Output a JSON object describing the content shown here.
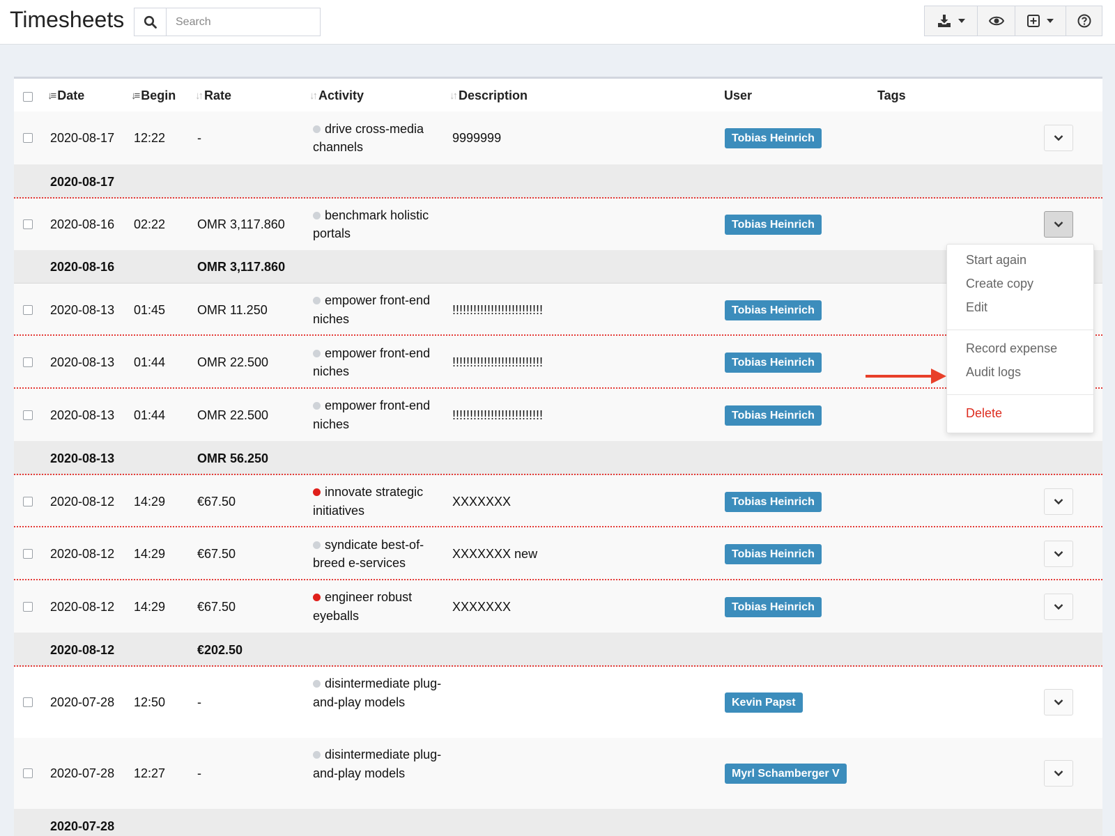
{
  "app": {
    "title": "Timesheets"
  },
  "search": {
    "placeholder": "Search"
  },
  "toolbar": {
    "buttons": [
      {
        "name": "export",
        "icon": "download-icon"
      },
      {
        "name": "visibility",
        "icon": "eye-icon"
      },
      {
        "name": "create",
        "icon": "plus-square-icon"
      },
      {
        "name": "help",
        "icon": "question-icon"
      }
    ]
  },
  "table": {
    "headers": {
      "date": "Date",
      "begin": "Begin",
      "rate": "Rate",
      "activity": "Activity",
      "description": "Description",
      "user": "User",
      "tags": "Tags"
    },
    "rows": [
      {
        "date": "2020-08-17",
        "begin": "12:22",
        "rate": "-",
        "activity": "drive cross-media channels",
        "activity_color": "#cfd3d8",
        "description": "9999999",
        "user": "Tobias Heinrich"
      },
      {
        "date": "2020-08-16",
        "begin": "02:22",
        "rate": "OMR 3,117.860",
        "activity": "benchmark holistic portals",
        "activity_color": "#cfd3d8",
        "description": "",
        "user": "Tobias Heinrich"
      },
      {
        "date": "2020-08-13",
        "begin": "01:45",
        "rate": "OMR 11.250",
        "activity": "empower front-end niches",
        "activity_color": "#cfd3d8",
        "description": "!!!!!!!!!!!!!!!!!!!!!!!!!!",
        "user": "Tobias Heinrich"
      },
      {
        "date": "2020-08-13",
        "begin": "01:44",
        "rate": "OMR 22.500",
        "activity": "empower front-end niches",
        "activity_color": "#cfd3d8",
        "description": "!!!!!!!!!!!!!!!!!!!!!!!!!!",
        "user": "Tobias Heinrich"
      },
      {
        "date": "2020-08-13",
        "begin": "01:44",
        "rate": "OMR 22.500",
        "activity": "empower front-end niches",
        "activity_color": "#cfd3d8",
        "description": "!!!!!!!!!!!!!!!!!!!!!!!!!!",
        "user": "Tobias Heinrich"
      },
      {
        "date": "2020-08-12",
        "begin": "14:29",
        "rate": "€67.50",
        "activity": "innovate strategic initiatives",
        "activity_color": "#e0201b",
        "description": "XXXXXXX",
        "user": "Tobias Heinrich"
      },
      {
        "date": "2020-08-12",
        "begin": "14:29",
        "rate": "€67.50",
        "activity": "syndicate best-of-breed e-services",
        "activity_color": "#cfd3d8",
        "description": "XXXXXXX new",
        "user": "Tobias Heinrich"
      },
      {
        "date": "2020-08-12",
        "begin": "14:29",
        "rate": "€67.50",
        "activity": "engineer robust eyeballs",
        "activity_color": "#e0201b",
        "description": "XXXXXXX",
        "user": "Tobias Heinrich"
      },
      {
        "date": "2020-07-28",
        "begin": "12:50",
        "rate": "-",
        "activity": "disintermediate plug-and-play models",
        "activity_color": "#cfd3d8",
        "description": "",
        "user": "Kevin Papst"
      },
      {
        "date": "2020-07-28",
        "begin": "12:27",
        "rate": "-",
        "activity": "disintermediate plug-and-play models",
        "activity_color": "#cfd3d8",
        "description": "",
        "user": "Myrl Schamberger V"
      }
    ],
    "summaries": [
      {
        "date": "2020-08-17",
        "rate": ""
      },
      {
        "date": "2020-08-16",
        "rate": "OMR 3,117.860"
      },
      {
        "date": "2020-08-13",
        "rate": "OMR 56.250"
      },
      {
        "date": "2020-08-12",
        "rate": "€202.50"
      },
      {
        "date": "2020-07-28",
        "rate": ""
      }
    ]
  },
  "menu": {
    "items": [
      "Start again",
      "Create copy",
      "Edit",
      "Record expense",
      "Audit logs",
      "Delete"
    ]
  },
  "colors": {
    "badge": "#3c8dbc",
    "danger": "#dd2d20",
    "arrow": "#e8402a"
  }
}
